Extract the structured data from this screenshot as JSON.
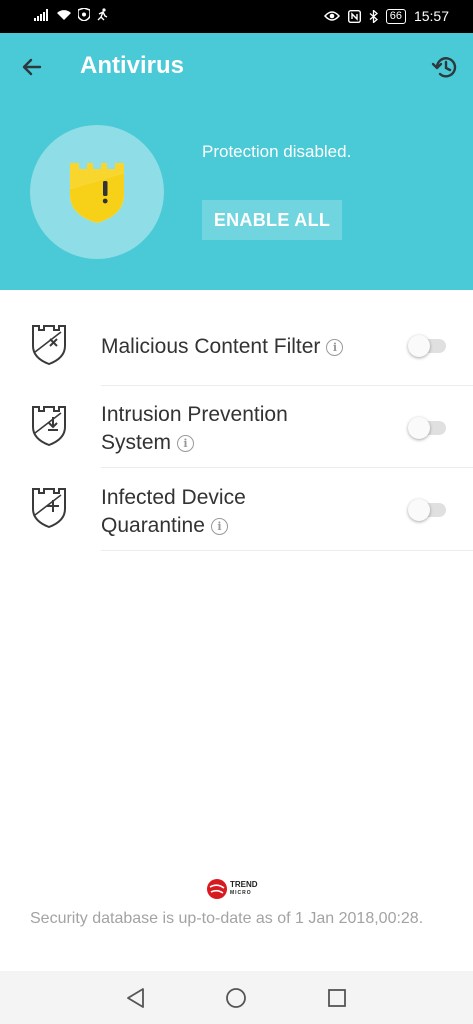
{
  "status_bar": {
    "time": "15:57",
    "battery": "66",
    "left_icons": [
      "signal-icon",
      "wifi-icon",
      "shield-status-icon",
      "running-icon"
    ],
    "right_icons": [
      "eye-icon",
      "nfc-icon",
      "bluetooth-icon",
      "battery-icon"
    ]
  },
  "header": {
    "title": "Antivirus",
    "status_text": "Protection disabled.",
    "enable_button": "ENABLE ALL",
    "colors": {
      "background": "#4ac9d6",
      "shield": "#f7d117"
    }
  },
  "features": [
    {
      "label_line1": "Malicious Content Filter",
      "label_line2": "",
      "icon": "shield-x-icon",
      "enabled": false
    },
    {
      "label_line1": "Intrusion Prevention",
      "label_line2": "System",
      "icon": "shield-download-icon",
      "enabled": false
    },
    {
      "label_line1": "Infected Device",
      "label_line2": "Quarantine",
      "icon": "shield-plus-icon",
      "enabled": false
    }
  ],
  "footer": {
    "brand_line1": "TREND",
    "brand_line2": "MICRO",
    "database_text": "Security database is up-to-date as of 1 Jan 2018,00:28."
  },
  "navigation": [
    "back-icon",
    "home-icon",
    "recents-icon"
  ]
}
